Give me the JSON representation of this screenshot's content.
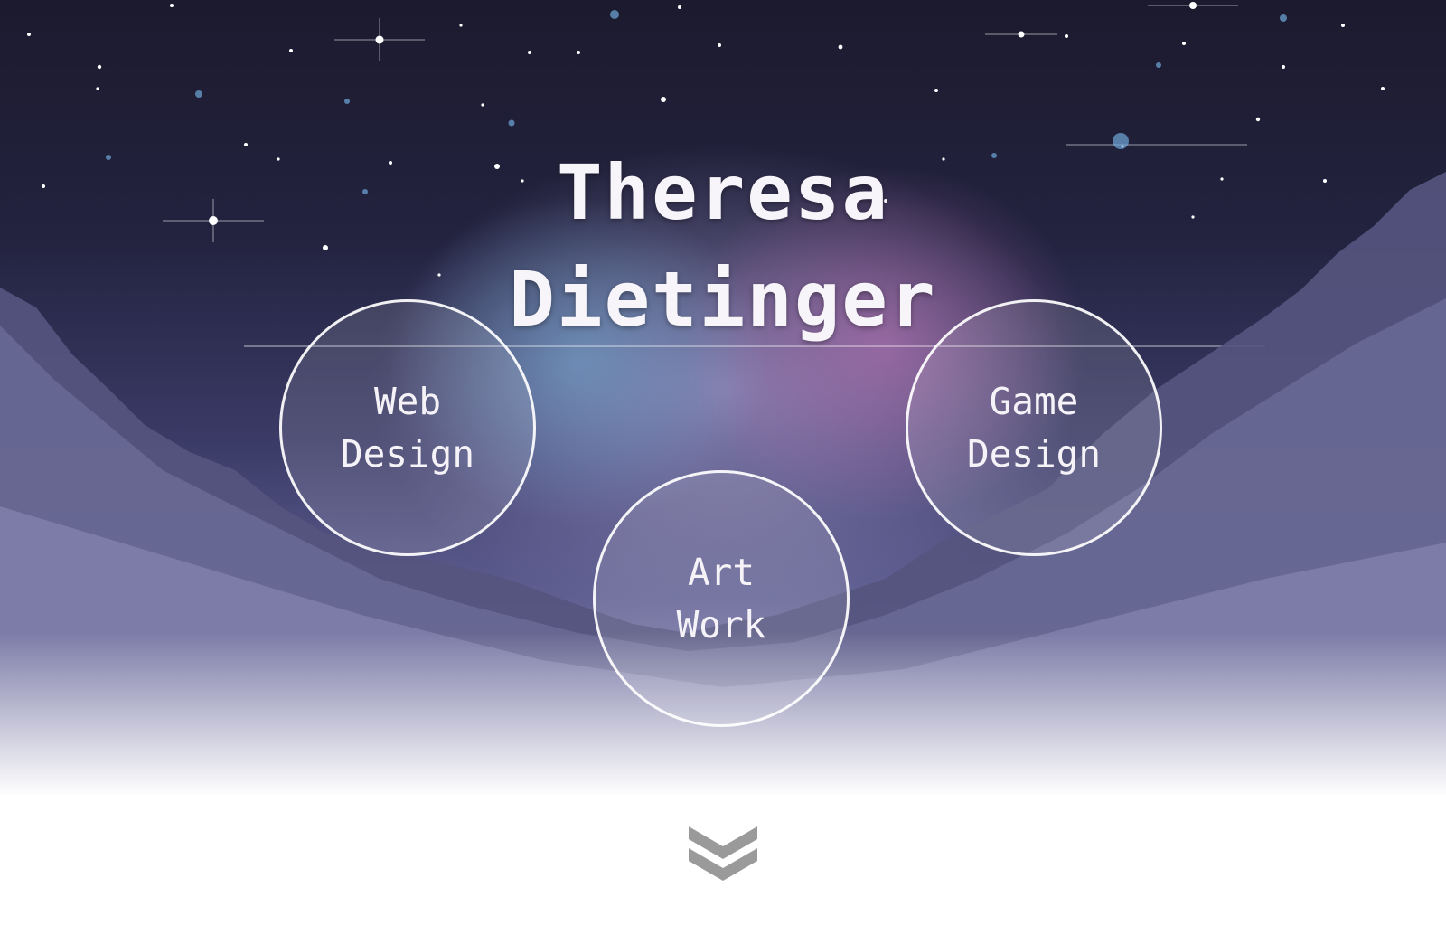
{
  "hero": {
    "title_line1": "Theresa",
    "title_line2": "Dietinger"
  },
  "nav": {
    "web_design": "Web\nDesign",
    "game_design": "Game\nDesign",
    "art_work": "Art\nWork"
  },
  "icons": {
    "scroll": "double-chevron-down-icon"
  },
  "colors": {
    "title_text": "#f7f5fa",
    "circle_border": "#ffffff",
    "scroll_icon": "#9a9a9a"
  }
}
